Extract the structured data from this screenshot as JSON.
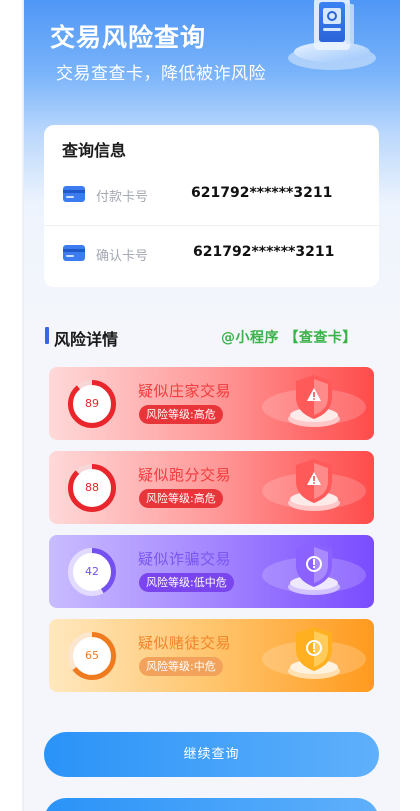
{
  "header": {
    "title": "交易风险查询",
    "subtitle": "交易查查卡，降低被诈风险"
  },
  "query_info": {
    "title": "查询信息",
    "rows": [
      {
        "label": "付款卡号",
        "value": "621792******3211",
        "icon": "bank-card-icon"
      },
      {
        "label": "确认卡号",
        "value": "621792******3211",
        "icon": "bank-card-icon"
      }
    ]
  },
  "risk_section": {
    "title": "风险详情",
    "mini_program_tag": "@小程序 【查查卡】"
  },
  "risk_items": [
    {
      "score": "89",
      "score_fraction": 0.89,
      "name": "疑似庄家交易",
      "level": "风险等级:高危",
      "name_color": "#f03c3c",
      "accent": "#e8262b",
      "badge_bg": "#e8353a",
      "track": "#f6d6d6"
    },
    {
      "score": "88",
      "score_fraction": 0.88,
      "name": "疑似跑分交易",
      "level": "风险等级:高危",
      "name_color": "#f03c3c",
      "accent": "#e8262b",
      "badge_bg": "#e8353a",
      "track": "#f6d6d6"
    },
    {
      "score": "42",
      "score_fraction": 0.42,
      "name": "疑似诈骗交易",
      "level": "风险等级:低中危",
      "name_color": "#7a55f0",
      "accent": "#7450f2",
      "badge_bg": "#7a45ee",
      "track": "#e2dbff"
    },
    {
      "score": "65",
      "score_fraction": 0.65,
      "name": "疑似赌徒交易",
      "level": "风险等级:中危",
      "name_color": "#f0852a",
      "accent": "#f07a1e",
      "badge_bg": "#f2a25a",
      "track": "#fbe6cf"
    }
  ],
  "actions": {
    "continue_label": "继续查询"
  }
}
